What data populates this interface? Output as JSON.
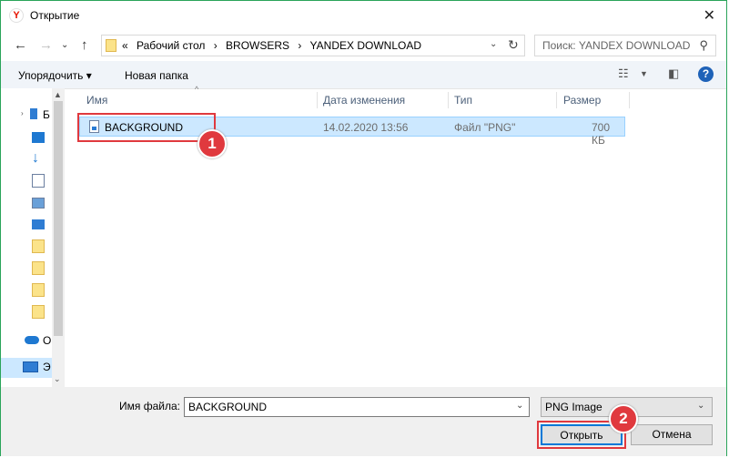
{
  "window": {
    "title": "Открытие",
    "app_icon_letter": "Y"
  },
  "address_bar": {
    "crumbs": [
      "«",
      "Рабочий стол",
      "›",
      "BROWSERS",
      "›",
      "YANDEX DOWNLOAD"
    ]
  },
  "search": {
    "placeholder": "Поиск: YANDEX DOWNLOAD"
  },
  "toolbar": {
    "organize_label": "Упорядочить ▾",
    "new_folder_label": "Новая папка"
  },
  "nav_pane": {
    "items": [
      "Б",
      "О",
      "Э"
    ]
  },
  "columns": {
    "name": "Имя",
    "date": "Дата изменения",
    "type": "Тип",
    "size": "Размер"
  },
  "files": [
    {
      "name": "BACKGROUND",
      "date": "14.02.2020 13:56",
      "type": "Файл \"PNG\"",
      "size": "700 КБ"
    }
  ],
  "bottom": {
    "filename_label": "Имя файла:",
    "filename_value": "BACKGROUND",
    "filetype_value": "PNG Image",
    "open_label": "Открыть",
    "cancel_label": "Отмена"
  },
  "annotations": {
    "badge1": "1",
    "badge2": "2"
  },
  "colors": {
    "accent": "#0078d7",
    "selection": "#cce8ff",
    "callout": "#e0393e",
    "help": "#1e62b8"
  }
}
